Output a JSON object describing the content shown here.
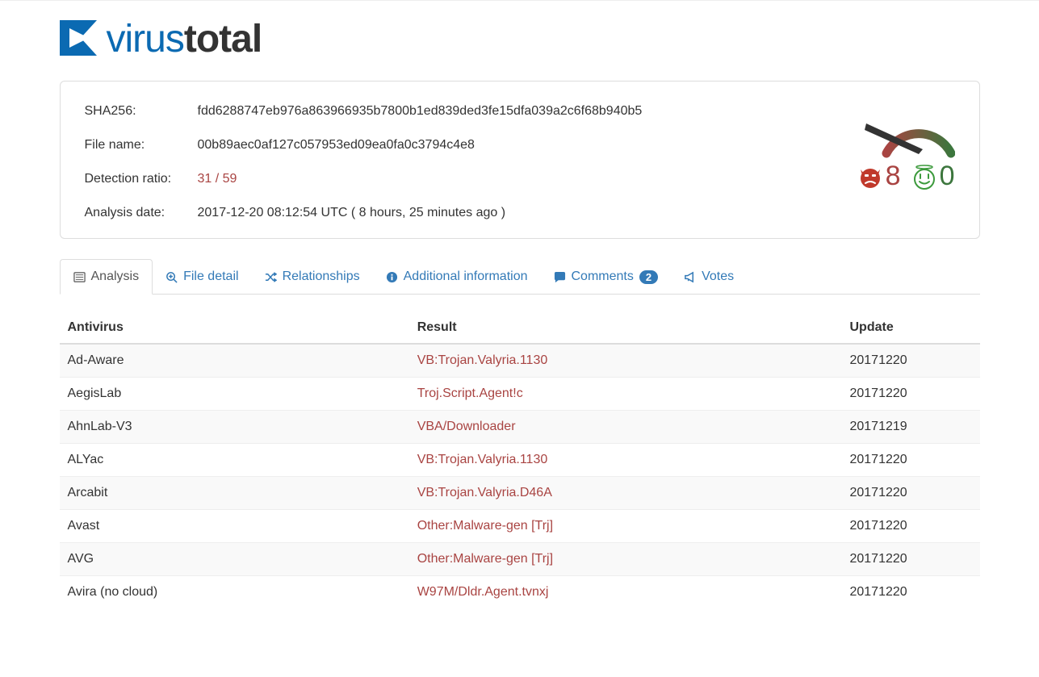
{
  "brand": {
    "virus": "virus",
    "total": "total"
  },
  "info": {
    "sha256_label": "SHA256:",
    "sha256_value": "fdd6288747eb976a863966935b7800b1ed839ded3fe15dfa039a2c6f68b940b5",
    "filename_label": "File name:",
    "filename_value": "00b89aec0af127c057953ed09ea0fa0c3794c4e8",
    "ratio_label": "Detection ratio:",
    "ratio_value": "31 / 59",
    "date_label": "Analysis date:",
    "date_value": "2017-12-20 08:12:54 UTC ( 8 hours, 25 minutes ago )"
  },
  "votes": {
    "bad": "8",
    "good": "0"
  },
  "tabs": {
    "analysis": "Analysis",
    "file_detail": "File detail",
    "relationships": "Relationships",
    "additional": "Additional information",
    "comments": "Comments",
    "comments_count": "2",
    "votes": "Votes"
  },
  "headers": {
    "antivirus": "Antivirus",
    "result": "Result",
    "update": "Update"
  },
  "rows": [
    {
      "av": "Ad-Aware",
      "result": "VB:Trojan.Valyria.1130",
      "update": "20171220"
    },
    {
      "av": "AegisLab",
      "result": "Troj.Script.Agent!c",
      "update": "20171220"
    },
    {
      "av": "AhnLab-V3",
      "result": "VBA/Downloader",
      "update": "20171219"
    },
    {
      "av": "ALYac",
      "result": "VB:Trojan.Valyria.1130",
      "update": "20171220"
    },
    {
      "av": "Arcabit",
      "result": "VB:Trojan.Valyria.D46A",
      "update": "20171220"
    },
    {
      "av": "Avast",
      "result": "Other:Malware-gen [Trj]",
      "update": "20171220"
    },
    {
      "av": "AVG",
      "result": "Other:Malware-gen [Trj]",
      "update": "20171220"
    },
    {
      "av": "Avira (no cloud)",
      "result": "W97M/Dldr.Agent.tvnxj",
      "update": "20171220"
    }
  ]
}
